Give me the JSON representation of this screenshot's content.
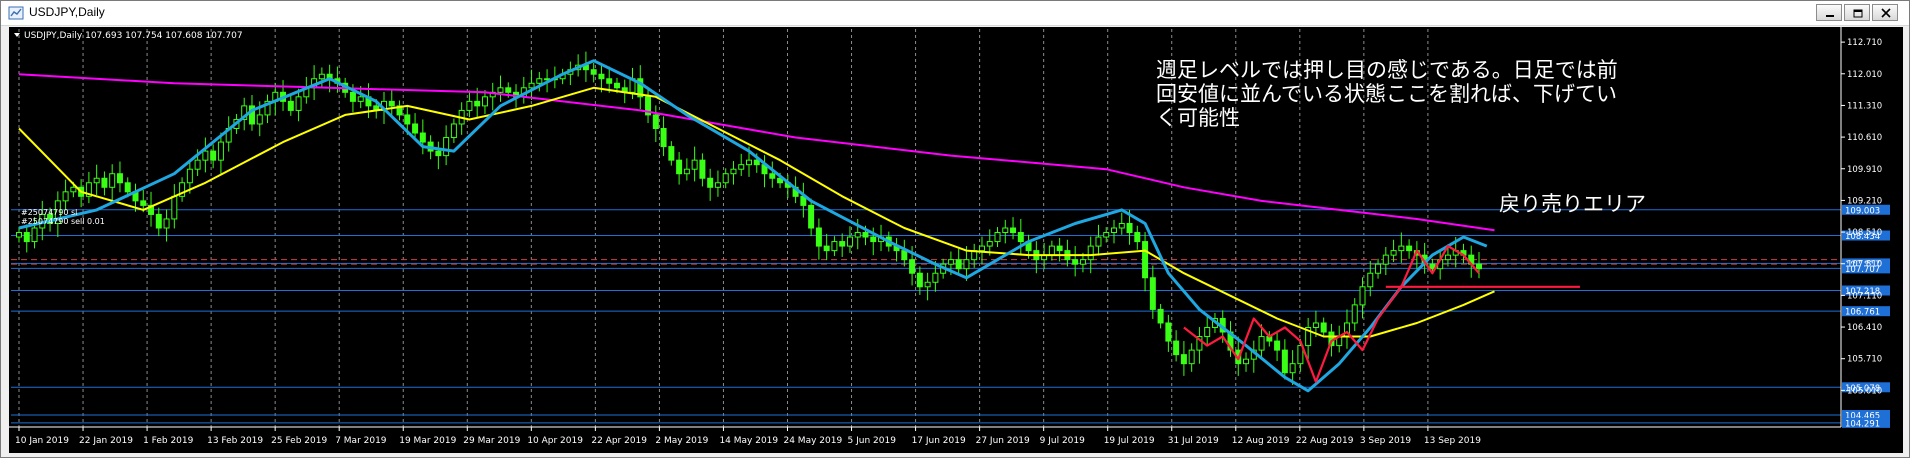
{
  "window": {
    "title": "USDJPY,Daily",
    "icons": {
      "app": "chart-window-icon",
      "minimize": "minimize-icon",
      "restore": "restore-icon",
      "close": "close-icon"
    }
  },
  "chart": {
    "header": "USDJPY,Daily  107.693 107.754 107.608 107.707",
    "annotation_lines": [
      "週足レベルでは押し目の感じである。日足では前",
      "回安値に並んでいる状態ここを割れば、下げてい",
      "く可能性"
    ],
    "zone_label": "戻り売りエリア",
    "order_labels": [
      "#25074790 sl",
      "#25074790 sell 0.01"
    ],
    "colors": {
      "background": "#000000",
      "axis": "#ffffff",
      "bull_candle": "#39ff14",
      "bear_candle": "#39ff14",
      "ma_fast": "#1ea7e1",
      "ma_mid": "#ffff00",
      "ma_slow": "#ff00ff",
      "levels": "#1e6fd6",
      "annotation": "#ff1a40",
      "order_line": "#d04040"
    }
  },
  "chart_data": {
    "type": "candlestick",
    "symbol": "USDJPY",
    "timeframe": "Daily",
    "ohlc_last": {
      "open": 107.693,
      "high": 107.754,
      "low": 107.608,
      "close": 107.707
    },
    "ylim": [
      104.2,
      113.0
    ],
    "y_ticks": [
      112.71,
      112.01,
      111.31,
      110.61,
      109.91,
      109.21,
      108.51,
      107.81,
      107.11,
      106.41,
      105.71,
      105.01
    ],
    "x_ticks": [
      "10 Jan 2019",
      "22 Jan 2019",
      "1 Feb 2019",
      "13 Feb 2019",
      "25 Feb 2019",
      "7 Mar 2019",
      "19 Mar 2019",
      "29 Mar 2019",
      "10 Apr 2019",
      "22 Apr 2019",
      "2 May 2019",
      "14 May 2019",
      "24 May 2019",
      "5 Jun 2019",
      "17 Jun 2019",
      "27 Jun 2019",
      "9 Jul 2019",
      "19 Jul 2019",
      "31 Jul 2019",
      "12 Aug 2019",
      "22 Aug 2019",
      "3 Sep 2019",
      "13 Sep 2019"
    ],
    "grid_dates": [
      "31 Jul 2019",
      "3 Sep 2019"
    ],
    "horizontal_levels": [
      {
        "value": 109.003,
        "label": "109.003"
      },
      {
        "value": 108.434,
        "label": "108.434"
      },
      {
        "value": 107.817,
        "label": "107.817"
      },
      {
        "value": 107.707,
        "label": "107.707"
      },
      {
        "value": 107.218,
        "label": "107.218"
      },
      {
        "value": 106.761,
        "label": "106.761"
      },
      {
        "value": 105.078,
        "label": "105.078"
      },
      {
        "value": 104.465,
        "label": "104.465"
      },
      {
        "value": 104.291,
        "label": "104.291"
      }
    ],
    "order_lines": [
      {
        "label": "#25074790 sl",
        "value": 107.9
      },
      {
        "label": "#25074790 sell 0.01",
        "value": 107.8
      }
    ],
    "closes": [
      108.5,
      108.3,
      108.6,
      108.9,
      108.7,
      109.2,
      109.4,
      109.5,
      109.3,
      109.6,
      109.7,
      109.5,
      109.8,
      109.6,
      109.4,
      109.2,
      109.1,
      108.9,
      108.6,
      108.8,
      109.3,
      109.6,
      109.9,
      110.1,
      110.3,
      110.1,
      110.5,
      110.8,
      111.0,
      111.3,
      110.9,
      111.1,
      111.4,
      111.6,
      111.4,
      111.2,
      111.5,
      111.7,
      111.9,
      112.0,
      111.9,
      111.8,
      111.6,
      111.4,
      111.5,
      111.3,
      111.2,
      111.4,
      111.3,
      111.1,
      110.9,
      110.7,
      110.5,
      110.3,
      110.2,
      110.6,
      110.9,
      111.2,
      111.4,
      111.3,
      111.5,
      111.6,
      111.7,
      111.6,
      111.5,
      111.7,
      111.8,
      111.9,
      111.9,
      111.9,
      112.0,
      112.1,
      112.2,
      112.1,
      112.0,
      111.9,
      111.8,
      111.7,
      111.6,
      111.9,
      111.5,
      111.1,
      110.8,
      110.4,
      110.1,
      109.8,
      109.9,
      110.1,
      109.7,
      109.5,
      109.6,
      109.8,
      109.9,
      110.0,
      110.1,
      110.0,
      109.8,
      109.7,
      109.6,
      109.5,
      109.3,
      109.1,
      108.6,
      108.2,
      108.1,
      108.3,
      108.2,
      108.4,
      108.5,
      108.4,
      108.3,
      108.4,
      108.2,
      108.1,
      107.9,
      107.6,
      107.3,
      107.4,
      107.6,
      107.8,
      107.9,
      107.7,
      107.9,
      108.1,
      108.2,
      108.3,
      108.5,
      108.6,
      108.5,
      108.3,
      108.1,
      107.9,
      108.0,
      108.2,
      108.1,
      107.9,
      107.8,
      107.9,
      108.2,
      108.4,
      108.5,
      108.6,
      108.7,
      108.5,
      108.3,
      107.5,
      106.8,
      106.5,
      106.1,
      105.8,
      105.6,
      105.9,
      106.2,
      106.4,
      106.6,
      106.3,
      105.9,
      105.6,
      105.7,
      105.9,
      106.2,
      106.1,
      105.9,
      105.4,
      105.6,
      106.0,
      106.4,
      106.5,
      106.3,
      106.0,
      106.2,
      106.5,
      106.9,
      107.3,
      107.6,
      107.8,
      108.0,
      108.1,
      108.2,
      108.1,
      108.0,
      107.8,
      107.7,
      107.9,
      108.0,
      108.1,
      108.0,
      107.8,
      107.7
    ],
    "ma_fast_points": [
      [
        0,
        108.6
      ],
      [
        10,
        109.0
      ],
      [
        20,
        109.8
      ],
      [
        30,
        111.2
      ],
      [
        40,
        111.9
      ],
      [
        46,
        111.4
      ],
      [
        52,
        110.4
      ],
      [
        56,
        110.3
      ],
      [
        62,
        111.3
      ],
      [
        70,
        112.0
      ],
      [
        74,
        112.3
      ],
      [
        80,
        111.8
      ],
      [
        86,
        111.1
      ],
      [
        94,
        110.3
      ],
      [
        102,
        109.2
      ],
      [
        112,
        108.3
      ],
      [
        118,
        107.8
      ],
      [
        122,
        107.5
      ],
      [
        126,
        107.9
      ],
      [
        130,
        108.3
      ],
      [
        136,
        108.7
      ],
      [
        142,
        109.0
      ],
      [
        145,
        108.7
      ],
      [
        148,
        107.6
      ],
      [
        152,
        106.8
      ],
      [
        158,
        106.0
      ],
      [
        163,
        105.3
      ],
      [
        166,
        105.0
      ],
      [
        170,
        105.6
      ],
      [
        174,
        106.4
      ],
      [
        178,
        107.3
      ],
      [
        182,
        108.0
      ],
      [
        186,
        108.4
      ],
      [
        189,
        108.2
      ]
    ],
    "ma_mid_points": [
      [
        0,
        110.8
      ],
      [
        8,
        109.4
      ],
      [
        16,
        109.0
      ],
      [
        24,
        109.6
      ],
      [
        34,
        110.5
      ],
      [
        42,
        111.1
      ],
      [
        50,
        111.3
      ],
      [
        58,
        111.0
      ],
      [
        66,
        111.3
      ],
      [
        74,
        111.7
      ],
      [
        82,
        111.5
      ],
      [
        90,
        110.8
      ],
      [
        98,
        110.1
      ],
      [
        106,
        109.3
      ],
      [
        114,
        108.6
      ],
      [
        122,
        108.1
      ],
      [
        130,
        108.0
      ],
      [
        138,
        108.0
      ],
      [
        145,
        108.1
      ],
      [
        150,
        107.6
      ],
      [
        156,
        107.1
      ],
      [
        162,
        106.6
      ],
      [
        168,
        106.2
      ],
      [
        174,
        106.2
      ],
      [
        180,
        106.5
      ],
      [
        186,
        106.9
      ],
      [
        190,
        107.2
      ]
    ],
    "ma_slow_points": [
      [
        0,
        112.0
      ],
      [
        20,
        111.8
      ],
      [
        40,
        111.7
      ],
      [
        60,
        111.6
      ],
      [
        80,
        111.2
      ],
      [
        100,
        110.6
      ],
      [
        120,
        110.2
      ],
      [
        140,
        109.9
      ],
      [
        150,
        109.5
      ],
      [
        160,
        109.2
      ],
      [
        170,
        109.0
      ],
      [
        180,
        108.8
      ],
      [
        190,
        108.55
      ]
    ],
    "red_drawing_points": [
      [
        150,
        106.4
      ],
      [
        153,
        106.0
      ],
      [
        155,
        106.2
      ],
      [
        157,
        105.7
      ],
      [
        159,
        106.6
      ],
      [
        161,
        106.2
      ],
      [
        163,
        106.4
      ],
      [
        165,
        106.1
      ],
      [
        167,
        105.2
      ],
      [
        169,
        106.1
      ],
      [
        171,
        106.3
      ],
      [
        173,
        105.9
      ],
      [
        175,
        106.6
      ],
      [
        178,
        107.3
      ],
      [
        180,
        108.1
      ],
      [
        182,
        107.6
      ],
      [
        184,
        108.2
      ],
      [
        186,
        108.0
      ],
      [
        188,
        107.6
      ]
    ],
    "red_horizontal": {
      "from_index": 176,
      "to_index": 201,
      "value": 107.3
    }
  }
}
